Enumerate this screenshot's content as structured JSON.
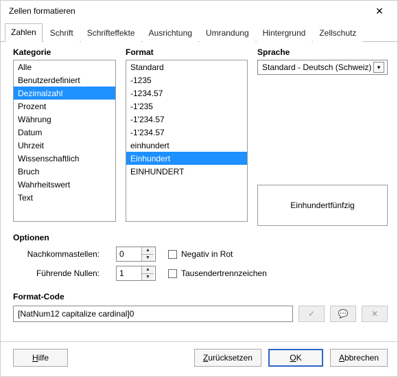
{
  "window": {
    "title": "Zellen formatieren"
  },
  "tabs": {
    "items": [
      {
        "label": "Zahlen",
        "active": true
      },
      {
        "label": "Schrift"
      },
      {
        "label": "Schrifteffekte"
      },
      {
        "label": "Ausrichtung"
      },
      {
        "label": "Umrandung"
      },
      {
        "label": "Hintergrund"
      },
      {
        "label": "Zellschutz"
      }
    ]
  },
  "headers": {
    "category": "Kategorie",
    "format": "Format",
    "language": "Sprache",
    "options": "Optionen",
    "format_code": "Format-Code"
  },
  "category": {
    "items": [
      "Alle",
      "Benutzerdefiniert",
      "Dezimalzahl",
      "Prozent",
      "Währung",
      "Datum",
      "Uhrzeit",
      "Wissenschaftlich",
      "Bruch",
      "Wahrheitswert",
      "Text"
    ],
    "selected_index": 2
  },
  "format": {
    "items": [
      "Standard",
      "-1235",
      "-1234.57",
      "-1'235",
      "-1'234.57",
      "-1'234.57",
      "einhundert",
      "Einhundert",
      "EINHUNDERT"
    ],
    "selected_index": 7
  },
  "language": {
    "value": "Standard - Deutsch (Schweiz)"
  },
  "preview": {
    "value": "Einhundertfünfzig"
  },
  "options": {
    "decimals_label": "Nachkommastellen:",
    "decimals_value": "0",
    "leading_label": "Führende Nullen:",
    "leading_value": "1",
    "negative_red": "Negativ in Rot",
    "thousands": "Tausendertrennzeichen"
  },
  "format_code": {
    "value": "[NatNum12 capitalize cardinal]0"
  },
  "buttons": {
    "help": "Hilfe",
    "reset": "Zurücksetzen",
    "ok": "OK",
    "cancel": "Abbrechen"
  }
}
